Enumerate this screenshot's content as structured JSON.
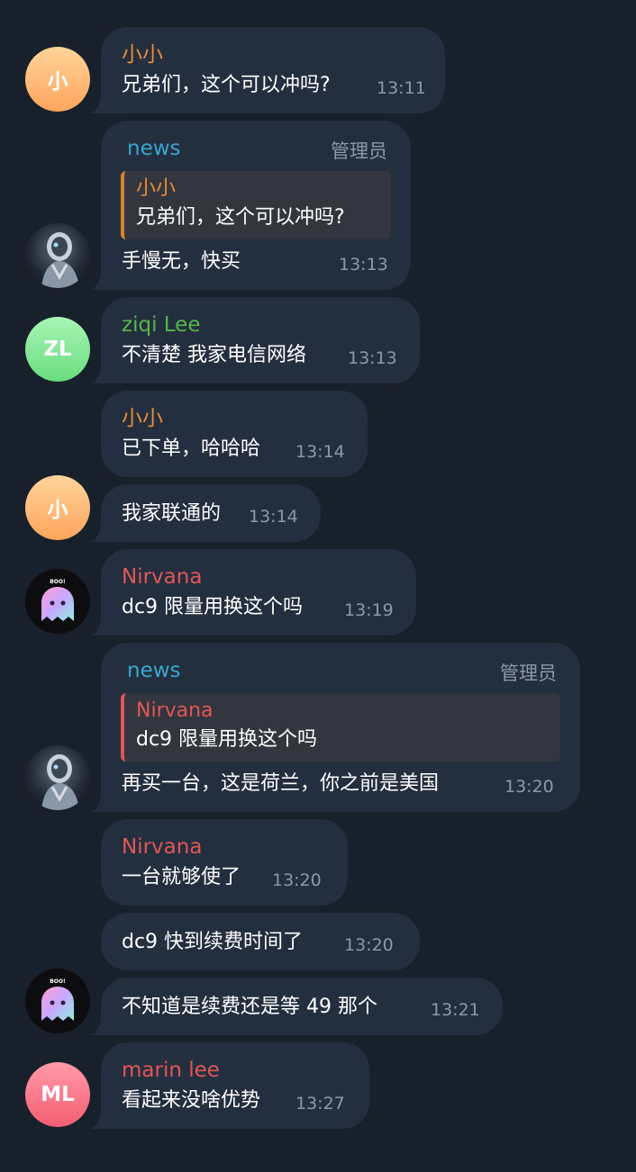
{
  "colors": {
    "background": "#18202b",
    "bubble": "#232f3f",
    "xiaoxiao": "#e88c38",
    "news": "#3aa6d0",
    "ziqi": "#55b84b",
    "nirvana": "#e25656",
    "marin": "#e25656",
    "meta": "#8d99a6"
  },
  "avatars": {
    "xiaoxiao": "小",
    "ziqi": "ZL",
    "marin": "ML",
    "robot_icon": "robot-avatar-icon",
    "ghost_icon": "ghost-avatar-icon",
    "ghost_text": "BOO!"
  },
  "messages": [
    {
      "sender": "小小",
      "text": "兄弟们，这个可以冲吗?",
      "time": "13:11"
    },
    {
      "sender": "news",
      "role": "管理员",
      "reply_to": {
        "sender": "小小",
        "text": "兄弟们，这个可以冲吗?"
      },
      "text": "手慢无，快买",
      "time": "13:13"
    },
    {
      "sender": "ziqi Lee",
      "text": "不清楚 我家电信网络",
      "time": "13:13"
    },
    {
      "sender": "小小",
      "text": "已下单，哈哈哈",
      "time": "13:14"
    },
    {
      "text": "我家联通的",
      "time": "13:14"
    },
    {
      "sender": "Nirvana",
      "text": "dc9 限量用换这个吗",
      "time": "13:19"
    },
    {
      "sender": "news",
      "role": "管理员",
      "reply_to": {
        "sender": "Nirvana",
        "text": "dc9 限量用换这个吗"
      },
      "text": "再买一台，这是荷兰，你之前是美国",
      "time": "13:20"
    },
    {
      "sender": "Nirvana",
      "text": "一台就够使了",
      "time": "13:20"
    },
    {
      "text": "dc9 快到续费时间了",
      "time": "13:20"
    },
    {
      "text": "不知道是续费还是等 49 那个",
      "time": "13:21"
    },
    {
      "sender": "marin lee",
      "text": "看起来没啥优势",
      "time": "13:27"
    }
  ]
}
